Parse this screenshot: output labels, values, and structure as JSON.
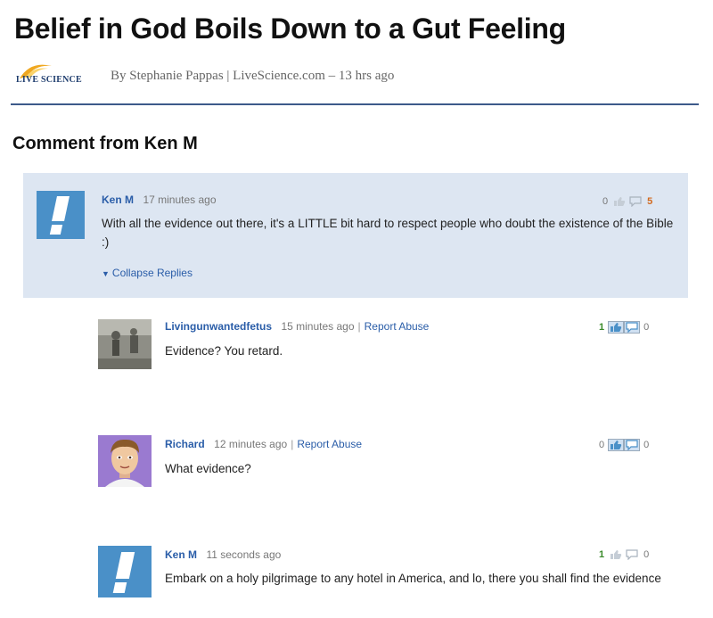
{
  "article": {
    "headline": "Belief in God Boils Down to a Gut Feeling",
    "logo_text": "LIVE SCIENCE",
    "byline": "By Stephanie Pappas | LiveScience.com – 13 hrs ago"
  },
  "section_title": "Comment from Ken M",
  "top_comment": {
    "author": "Ken M",
    "time": "17 minutes ago",
    "text": "With all the evidence out there, it's a LITTLE bit hard to respect people who doubt the existence of the Bible :)",
    "up_votes": "0",
    "down_votes": "5",
    "collapse_label": "Collapse Replies"
  },
  "replies": [
    {
      "author": "Livingunwantedfetus",
      "time": "15 minutes ago",
      "report": "Report Abuse",
      "text": "Evidence? You retard.",
      "up_votes": "1",
      "down_votes": "0"
    },
    {
      "author": "Richard",
      "time": "12 minutes ago",
      "report": "Report Abuse",
      "text": "What evidence?",
      "up_votes": "0",
      "down_votes": "0"
    },
    {
      "author": "Ken M",
      "time": "11 seconds ago",
      "text": "Embark on a holy pilgrimage to any hotel in America, and lo, there you shall find the evidence",
      "up_votes": "1",
      "down_votes": "0"
    }
  ],
  "colors": {
    "link_blue": "#2a5da8",
    "avatar_blue": "#4a90c8",
    "top_comment_bg": "#dde6f2",
    "rule": "#3d5a8a"
  },
  "icons": [
    "thumbs-up-icon",
    "thumbs-down-icon",
    "triangle-down-icon",
    "exclamation-avatar-icon"
  ]
}
